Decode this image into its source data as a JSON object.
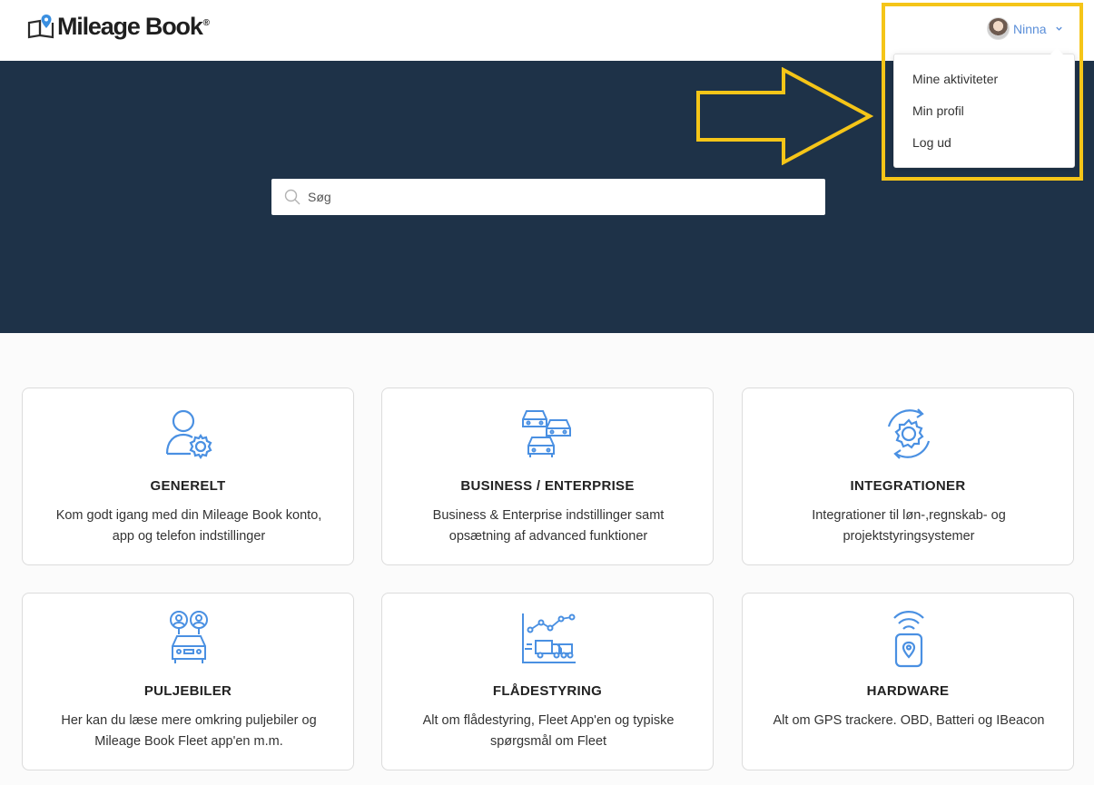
{
  "header": {
    "logo_text": "Mileage Book",
    "logo_reg": "®",
    "user_name": "Ninna"
  },
  "dropdown": {
    "items": [
      {
        "label": "Mine aktiviteter"
      },
      {
        "label": "Min profil"
      },
      {
        "label": "Log ud"
      }
    ]
  },
  "search": {
    "placeholder": "Søg"
  },
  "cards": [
    {
      "title": "GENERELT",
      "desc": "Kom godt igang med din Mileage Book konto, app og telefon indstillinger",
      "icon": "user-settings-icon"
    },
    {
      "title": "BUSINESS / ENTERPRISE",
      "desc": "Business & Enterprise indstillinger samt opsætning af advanced funktioner",
      "icon": "cars-fleet-icon"
    },
    {
      "title": "INTEGRATIONER",
      "desc": "Integrationer til løn-,regnskab- og projektstyringsystemer",
      "icon": "sync-gear-icon"
    },
    {
      "title": "PULJEBILER",
      "desc": "Her kan du læse mere omkring puljebiler og Mileage Book Fleet app'en m.m.",
      "icon": "shared-car-icon"
    },
    {
      "title": "FLÅDESTYRING",
      "desc": "Alt om flådestyring, Fleet App'en og typiske spørgsmål om Fleet",
      "icon": "fleet-chart-icon"
    },
    {
      "title": "HARDWARE",
      "desc": "Alt om GPS trackere. OBD, Batteri og IBeacon",
      "icon": "gps-tracker-icon"
    }
  ],
  "colors": {
    "hero_bg": "#1e3248",
    "accent_blue": "#4a90e2",
    "highlight_yellow": "#f5c518"
  }
}
